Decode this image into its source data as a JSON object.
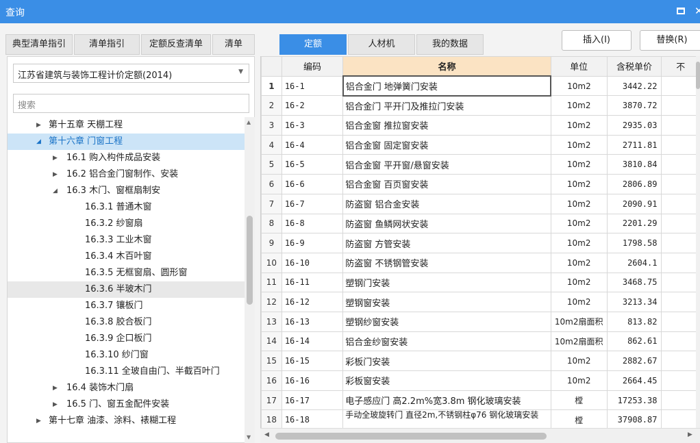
{
  "window": {
    "title": "查询"
  },
  "tabs": [
    {
      "label": "典型清单指引"
    },
    {
      "label": "清单指引"
    },
    {
      "label": "定额反查清单"
    },
    {
      "label": "清单"
    },
    {
      "label": "定额"
    },
    {
      "label": "人材机"
    },
    {
      "label": "我的数据"
    }
  ],
  "active_tab": "定额",
  "actions": {
    "insert": "插入(I)",
    "replace": "替换(R)"
  },
  "left": {
    "dropdown": "江苏省建筑与装饰工程计价定额(2014)",
    "search_placeholder": "搜索",
    "tree": [
      {
        "label": "第十五章 天棚工程",
        "toggle": "▶"
      },
      {
        "label": "第十六章 门窗工程",
        "toggle": "◢"
      },
      {
        "label": "16.1 购入构件成品安装",
        "toggle": "▶"
      },
      {
        "label": "16.2 铝合金门窗制作、安装",
        "toggle": "▶"
      },
      {
        "label": "16.3 木门、窗框扇制安",
        "toggle": "◢"
      },
      {
        "label": "16.3.1 普通木窗",
        "toggle": ""
      },
      {
        "label": "16.3.2 纱窗扇",
        "toggle": ""
      },
      {
        "label": "16.3.3 工业木窗",
        "toggle": ""
      },
      {
        "label": "16.3.4 木百叶窗",
        "toggle": ""
      },
      {
        "label": "16.3.5 无框窗扇、圆形窗",
        "toggle": ""
      },
      {
        "label": "16.3.6 半玻木门",
        "toggle": ""
      },
      {
        "label": "16.3.7 镶板门",
        "toggle": ""
      },
      {
        "label": "16.3.8 胶合板门",
        "toggle": ""
      },
      {
        "label": "16.3.9 企口板门",
        "toggle": ""
      },
      {
        "label": "16.3.10 纱门窗",
        "toggle": ""
      },
      {
        "label": "16.3.11 全玻自由门、半截百叶门",
        "toggle": ""
      },
      {
        "label": "16.4 装饰木门扇",
        "toggle": "▶"
      },
      {
        "label": "16.5 门、窗五金配件安装",
        "toggle": "▶"
      },
      {
        "label": "第十七章 油漆、涂料、裱糊工程",
        "toggle": "▶"
      }
    ]
  },
  "table": {
    "headers": {
      "code": "编码",
      "name": "名称",
      "unit": "单位",
      "price": "含税单价",
      "extra": "不"
    },
    "rows": [
      {
        "n": "1",
        "code": "16-1",
        "name": "铝合金门 地弹簧门安装",
        "unit": "10m2",
        "price": "3442.22"
      },
      {
        "n": "2",
        "code": "16-2",
        "name": "铝合金门 平开门及推拉门安装",
        "unit": "10m2",
        "price": "3870.72"
      },
      {
        "n": "3",
        "code": "16-3",
        "name": "铝合金窗 推拉窗安装",
        "unit": "10m2",
        "price": "2935.03"
      },
      {
        "n": "4",
        "code": "16-4",
        "name": "铝合金窗 固定窗安装",
        "unit": "10m2",
        "price": "2711.81"
      },
      {
        "n": "5",
        "code": "16-5",
        "name": "铝合金窗 平开窗/悬窗安装",
        "unit": "10m2",
        "price": "3810.84"
      },
      {
        "n": "6",
        "code": "16-6",
        "name": "铝合金窗 百页窗安装",
        "unit": "10m2",
        "price": "2806.89"
      },
      {
        "n": "7",
        "code": "16-7",
        "name": "防盗窗 铝合金安装",
        "unit": "10m2",
        "price": "2090.91"
      },
      {
        "n": "8",
        "code": "16-8",
        "name": "防盗窗 鱼鳞网状安装",
        "unit": "10m2",
        "price": "2201.29"
      },
      {
        "n": "9",
        "code": "16-9",
        "name": "防盗窗 方管安装",
        "unit": "10m2",
        "price": "1798.58"
      },
      {
        "n": "10",
        "code": "16-10",
        "name": "防盗窗 不锈钢管安装",
        "unit": "10m2",
        "price": "2604.1"
      },
      {
        "n": "11",
        "code": "16-11",
        "name": "塑钢门安装",
        "unit": "10m2",
        "price": "3468.75"
      },
      {
        "n": "12",
        "code": "16-12",
        "name": "塑钢窗安装",
        "unit": "10m2",
        "price": "3213.34"
      },
      {
        "n": "13",
        "code": "16-13",
        "name": "塑钢纱窗安装",
        "unit": "10m2扇面积",
        "price": "813.82"
      },
      {
        "n": "14",
        "code": "16-14",
        "name": "铝合金纱窗安装",
        "unit": "10m2扇面积",
        "price": "862.61"
      },
      {
        "n": "15",
        "code": "16-15",
        "name": "彩板门安装",
        "unit": "10m2",
        "price": "2882.67"
      },
      {
        "n": "16",
        "code": "16-16",
        "name": "彩板窗安装",
        "unit": "10m2",
        "price": "2664.45"
      },
      {
        "n": "17",
        "code": "16-17",
        "name": "电子感应门 高2.2m%宽3.8m 钢化玻璃安装",
        "unit": "樘",
        "price": "17253.38"
      },
      {
        "n": "18",
        "code": "16-18",
        "name": "手动全玻旋转门 直径2m,不锈钢柱φ76 钢化玻璃安装",
        "unit": "樘",
        "price": "37908.87"
      }
    ]
  },
  "colors": {
    "accent": "#3a8ee6",
    "selected_bg": "#cce4f7",
    "name_header": "#fbe3c3"
  }
}
